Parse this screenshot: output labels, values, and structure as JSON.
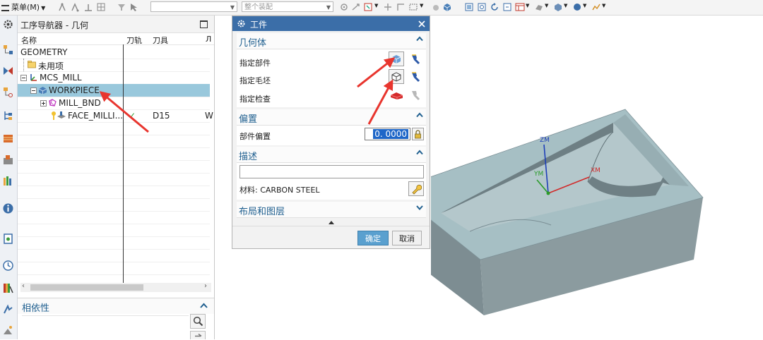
{
  "toolbar": {
    "menu_label": "菜单(M)",
    "combo1_value": "",
    "combo2_value": "整个装配"
  },
  "navigator": {
    "title": "工序导航器 - 几何",
    "columns": [
      "名称",
      "刀轨",
      "刀具",
      "Л"
    ],
    "rows": [
      {
        "name": "GEOMETRY",
        "path": "",
        "tool": "",
        "extra": ""
      },
      {
        "name": "未用项",
        "path": "",
        "tool": "",
        "extra": ""
      },
      {
        "name": "MCS_MILL",
        "path": "",
        "tool": "",
        "extra": ""
      },
      {
        "name": "WORKPIECE",
        "path": "",
        "tool": "",
        "extra": ""
      },
      {
        "name": "MILL_BND",
        "path": "",
        "tool": "",
        "extra": ""
      },
      {
        "name": "FACE_MILLI...",
        "path": "✓",
        "tool": "D15",
        "extra": "W"
      }
    ],
    "dependency_title": "相依性"
  },
  "dialog": {
    "title": "工件",
    "geometry_section": "几何体",
    "specify_part": "指定部件",
    "specify_blank": "指定毛坯",
    "specify_check": "指定检查",
    "offset_section": "偏置",
    "part_offset_label": "部件偏置",
    "part_offset_value": "0. 0000",
    "description_section": "描述",
    "description_value": "",
    "material_label": "材料: CARBON STEEL",
    "layout_section": "布局和图层",
    "ok_label": "确定",
    "cancel_label": "取消"
  },
  "viewport": {
    "axis_zm": "ZM",
    "axis_xm": "XM",
    "axis_ym": "YM"
  },
  "colors": {
    "selection": "#99c8dc",
    "dialog_title": "#3b6ea8",
    "section_text": "#1f5f8f",
    "annotation_arrow": "#e8352e",
    "part_face": "#a6bfc4"
  }
}
